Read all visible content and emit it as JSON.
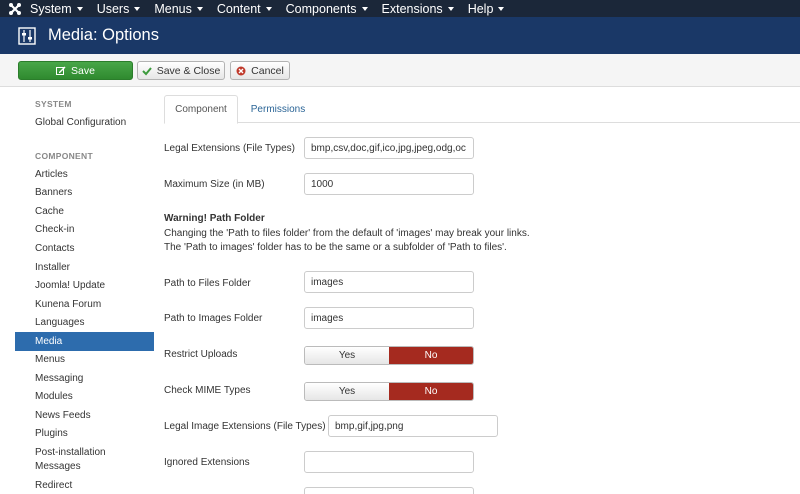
{
  "topbar": {
    "menus": [
      "System",
      "Users",
      "Menus",
      "Content",
      "Components",
      "Extensions",
      "Help"
    ]
  },
  "header": {
    "title": "Media: Options"
  },
  "toolbar": {
    "save": "Save",
    "save_close": "Save & Close",
    "cancel": "Cancel"
  },
  "sidebar": {
    "system_heading": "SYSTEM",
    "global_config": "Global Configuration",
    "component_heading": "COMPONENT",
    "items": [
      "Articles",
      "Banners",
      "Cache",
      "Check-in",
      "Contacts",
      "Installer",
      "Joomla! Update",
      "Kunena Forum",
      "Languages",
      "Media",
      "Menus",
      "Messaging",
      "Modules",
      "News Feeds",
      "Plugins",
      "Post-installation",
      "Messages",
      "Redirect"
    ],
    "active_item": "Media"
  },
  "tabs": {
    "component": "Component",
    "permissions": "Permissions"
  },
  "form": {
    "legal_extensions_label": "Legal Extensions (File Types)",
    "legal_extensions_value": "bmp,csv,doc,gif,ico,jpg,jpeg,odg,oc",
    "max_size_label": "Maximum Size (in MB)",
    "max_size_value": "1000",
    "warning_title": "Warning! Path Folder",
    "warning_line1": "Changing the 'Path to files folder' from the default of 'images' may break your links.",
    "warning_line2": "The 'Path to images' folder has to be the same or a subfolder of 'Path to files'.",
    "path_files_label": "Path to Files Folder",
    "path_files_value": "images",
    "path_images_label": "Path to Images Folder",
    "path_images_value": "images",
    "restrict_uploads_label": "Restrict Uploads",
    "check_mime_label": "Check MIME Types",
    "yes": "Yes",
    "no": "No",
    "legal_image_ext_label": "Legal Image Extensions (File Types)",
    "legal_image_ext_value": "bmp,gif,jpg,png",
    "ignored_ext_label": "Ignored Extensions",
    "ignored_ext_value": ""
  },
  "colors": {
    "topbar": "#1b2739",
    "titlebar": "#1a3867",
    "save_green": "#3c9a3c",
    "active_blue": "#2d6cad",
    "no_red": "#a52a1f"
  }
}
